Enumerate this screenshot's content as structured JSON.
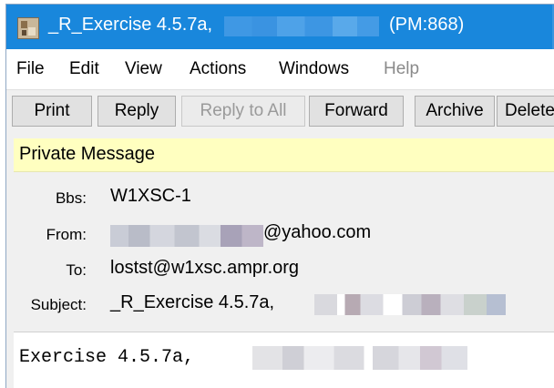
{
  "window": {
    "title_prefix": "_R_Exercise 4.5.7a,",
    "title_suffix": "(PM:868)",
    "accent_color": "#1987dc"
  },
  "menu": {
    "items": [
      {
        "label": "File",
        "enabled": true
      },
      {
        "label": "Edit",
        "enabled": true
      },
      {
        "label": "View",
        "enabled": true
      },
      {
        "label": "Actions",
        "enabled": true
      },
      {
        "label": "Windows",
        "enabled": true
      },
      {
        "label": "Help",
        "enabled": false
      }
    ]
  },
  "toolbar": {
    "buttons": [
      {
        "label": "Print",
        "enabled": true
      },
      {
        "label": "Reply",
        "enabled": true
      },
      {
        "label": "Reply to All",
        "enabled": false
      },
      {
        "label": "Forward",
        "enabled": true
      },
      {
        "label": "Archive",
        "enabled": true
      },
      {
        "label": "Delete",
        "enabled": true
      }
    ]
  },
  "message": {
    "banner": "Private Message",
    "banner_color": "#ffffc0",
    "bbs_label": "Bbs:",
    "bbs_value": "W1XSC-1",
    "from_label": "From:",
    "from_value_visible": "@yahoo.com",
    "to_label": "To:",
    "to_value": "lostst@w1xsc.ampr.org",
    "subject_label": "Subject:",
    "subject_value_visible": "_R_Exercise 4.5.7a,",
    "body_visible": "Exercise 4.5.7a,"
  }
}
